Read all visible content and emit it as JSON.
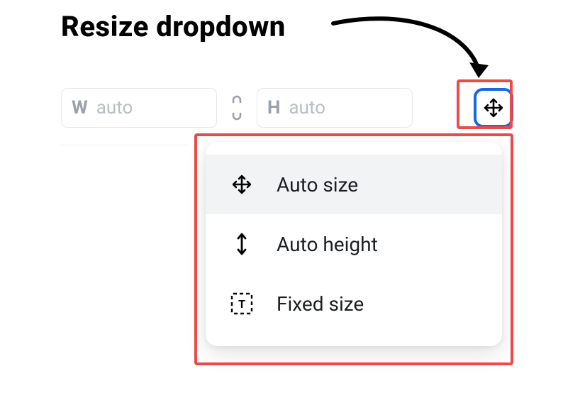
{
  "annotation": {
    "label": "Resize dropdown"
  },
  "width_field": {
    "letter": "W",
    "value": "auto"
  },
  "height_field": {
    "letter": "H",
    "value": "auto"
  },
  "menu": {
    "items": [
      {
        "label": "Auto size"
      },
      {
        "label": "Auto height"
      },
      {
        "label": "Fixed size"
      }
    ]
  }
}
